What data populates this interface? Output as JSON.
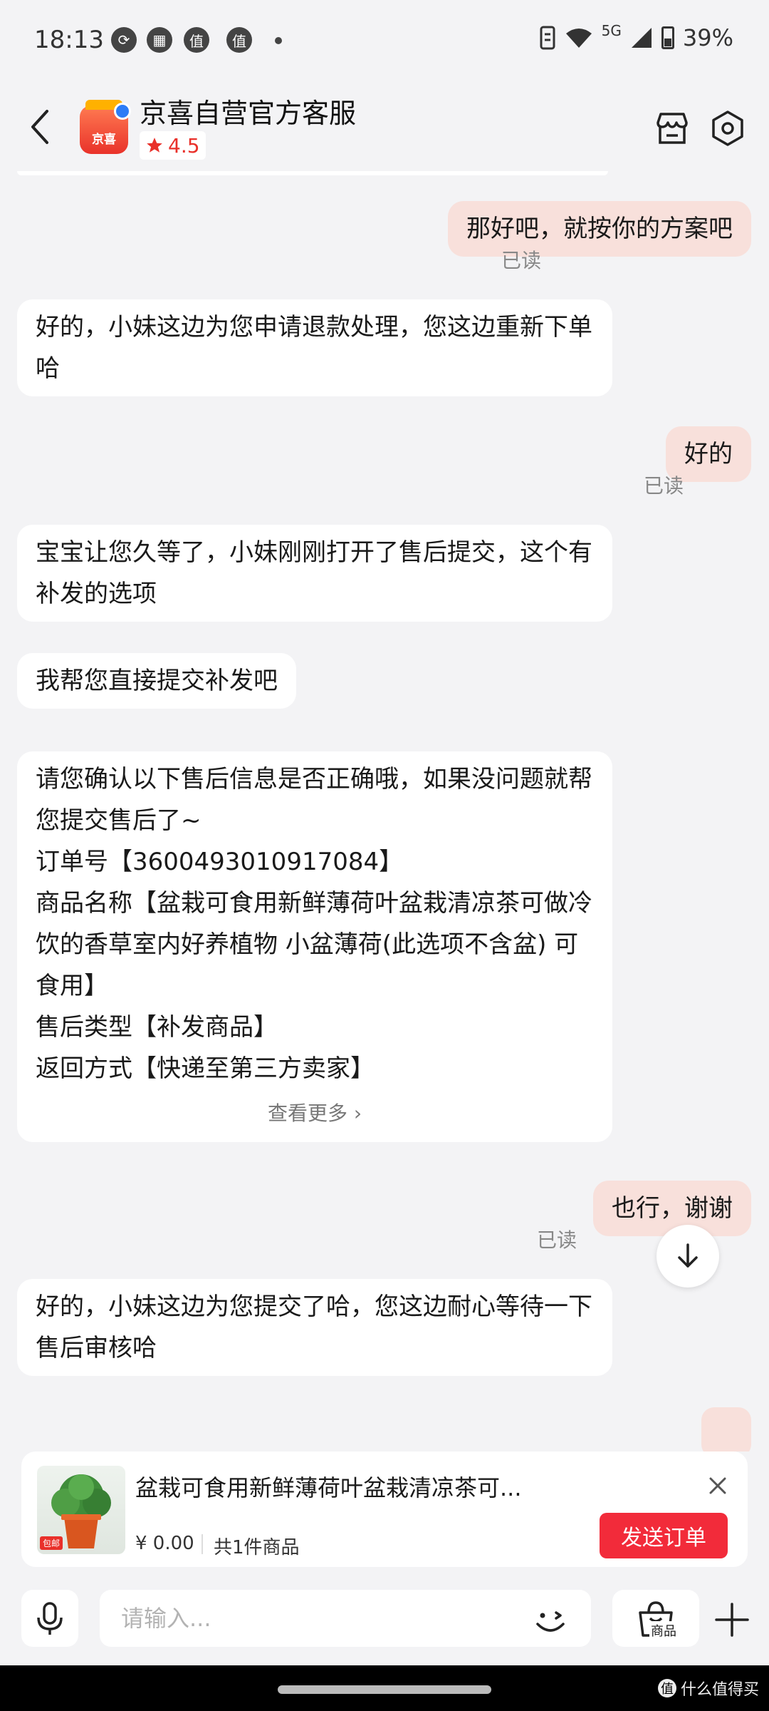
{
  "status_bar": {
    "time": "18:13",
    "icons": [
      "screen-record-icon",
      "calendar-icon",
      "zhi-app-icon",
      "zhi-app-icon"
    ],
    "zhi_glyph": "值",
    "network": "5G",
    "battery": "39%"
  },
  "header": {
    "shop_name": "京喜自营官方客服",
    "logo_text": "京喜",
    "rating": "4.5"
  },
  "messages": [
    {
      "side": "right",
      "text": "那好吧，就按你的方案吧",
      "read": "已读"
    },
    {
      "side": "left",
      "text": "好的，小妹这边为您申请退款处理，您这边重新下单哈"
    },
    {
      "side": "right",
      "text": "好的",
      "read": "已读"
    },
    {
      "side": "left",
      "text": "宝宝让您久等了，小妹刚刚打开了售后提交，这个有补发的选项"
    },
    {
      "side": "left",
      "text": "我帮您直接提交补发吧"
    },
    {
      "side": "left",
      "lines": [
        "请您确认以下售后信息是否正确哦，如果没问题就帮您提交售后了~",
        "订单号【3600493010917084】",
        "商品名称【盆栽可食用新鲜薄荷叶盆栽清凉茶可做冷饮的香草室内好养植物 小盆薄荷(此选项不含盆) 可食用】",
        "售后类型【补发商品】",
        "返回方式【快递至第三方卖家】"
      ],
      "more": "查看更多 ›"
    },
    {
      "side": "right",
      "text": "也行，谢谢",
      "read": "已读"
    },
    {
      "side": "left",
      "text": "好的，小妹这边为您提交了哈，您这边耐心等待一下售后审核哈"
    }
  ],
  "product_card": {
    "title": "盆栽可食用新鲜薄荷叶盆栽清凉茶可...",
    "price": "¥ 0.00",
    "count": "共1件商品",
    "send_button": "发送订单",
    "badge": "包邮"
  },
  "input_bar": {
    "placeholder": "请输入...",
    "goods_label": "商品"
  },
  "watermark": "什么值得买",
  "colors": {
    "accent_red": "#f22b3a",
    "right_bubble": "#f8e0db",
    "background": "#f3f3f5"
  }
}
